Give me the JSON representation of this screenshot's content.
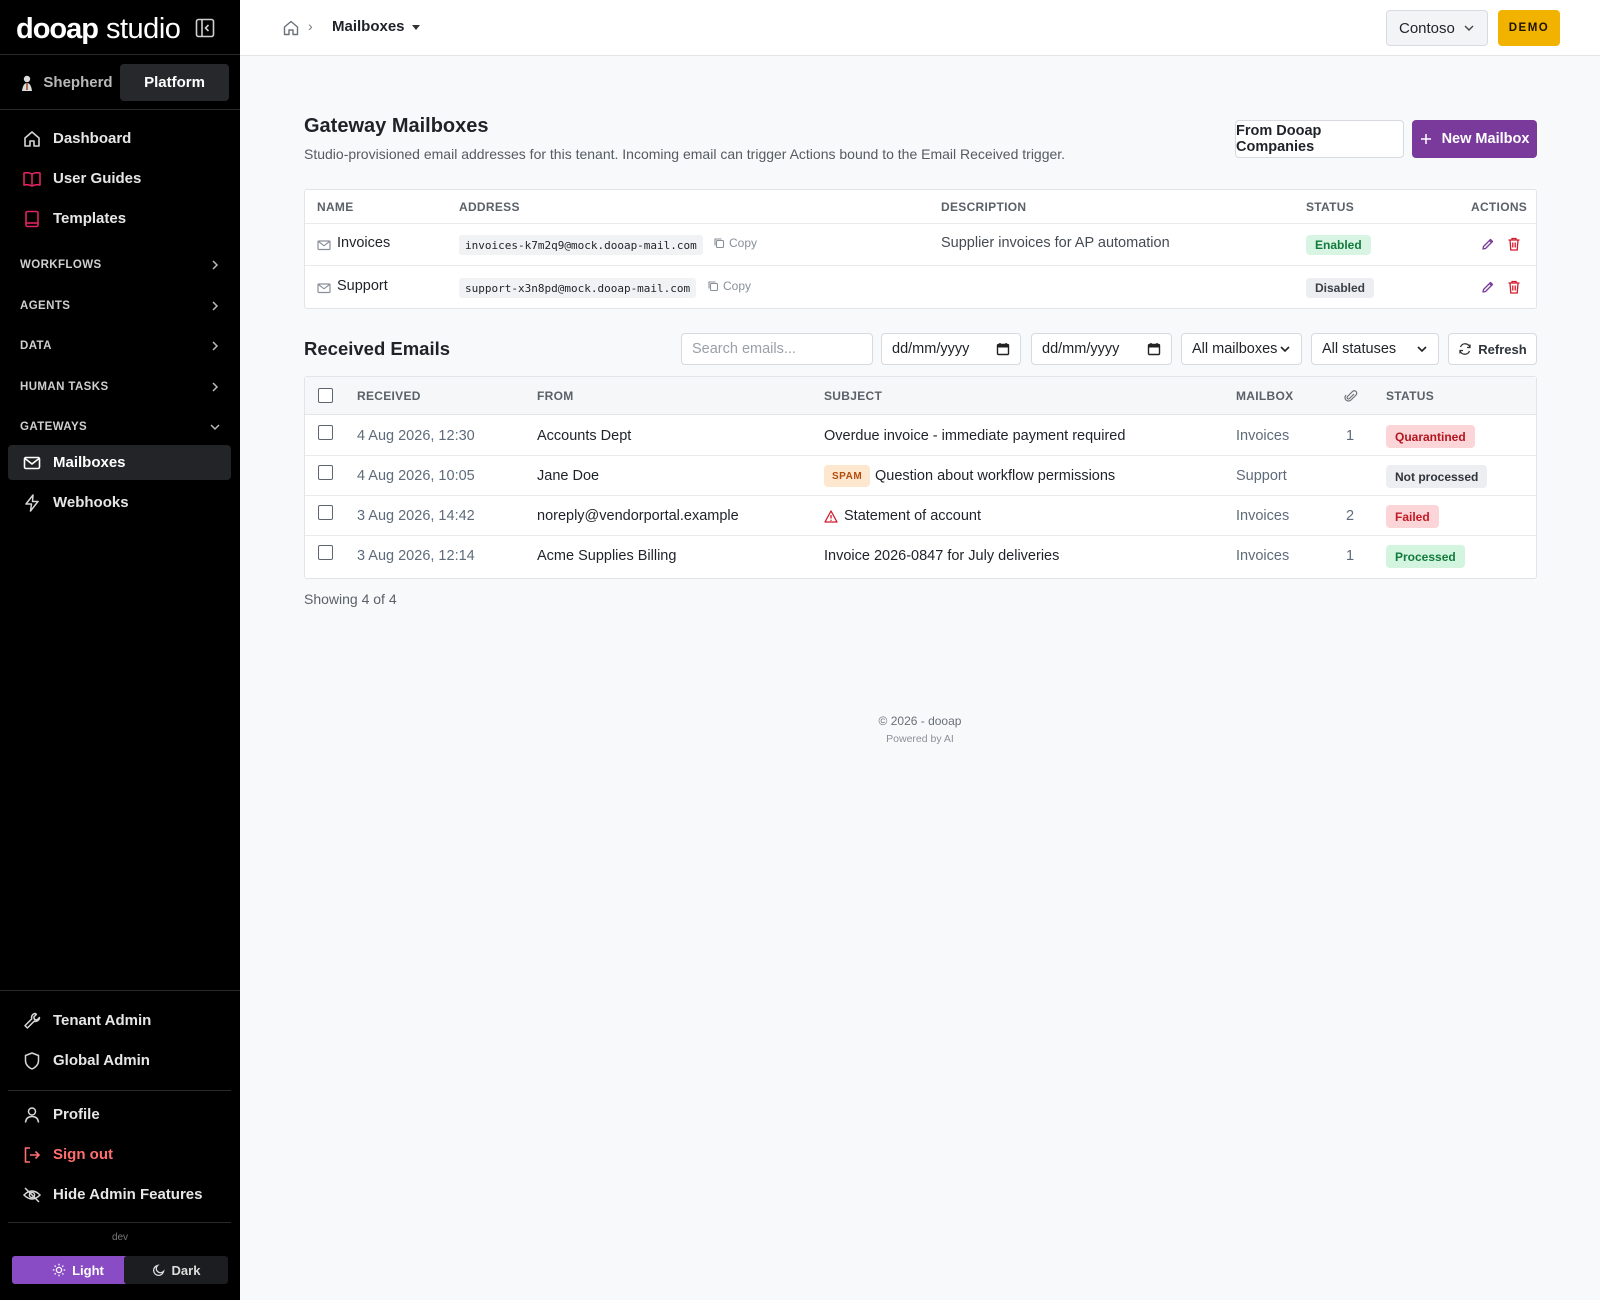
{
  "brand": {
    "name_bold": "dooap",
    "name_light": "studio"
  },
  "switcher": {
    "left": "Shepherd",
    "right": "Platform"
  },
  "nav": {
    "top_items": [
      {
        "label": "Dashboard",
        "icon": "home-icon"
      },
      {
        "label": "User Guides",
        "icon": "book-open-icon"
      },
      {
        "label": "Templates",
        "icon": "book-icon"
      }
    ],
    "sections": [
      {
        "label": "WORKFLOWS"
      },
      {
        "label": "AGENTS"
      },
      {
        "label": "DATA"
      },
      {
        "label": "HUMAN TASKS"
      },
      {
        "label": "GATEWAYS"
      }
    ],
    "gateway_items": [
      {
        "label": "Mailboxes",
        "icon": "mail-icon"
      },
      {
        "label": "Webhooks",
        "icon": "bolt-icon"
      }
    ],
    "admin_items": [
      {
        "label": "Tenant Admin",
        "icon": "wrench-icon"
      },
      {
        "label": "Global Admin",
        "icon": "shield-icon"
      }
    ],
    "account_items": [
      {
        "label": "Profile",
        "icon": "user-icon"
      },
      {
        "label": "Sign out",
        "icon": "sign-out-icon"
      },
      {
        "label": "Hide Admin Features",
        "icon": "eye-off-icon"
      }
    ],
    "env": "dev",
    "theme": {
      "light": "Light",
      "dark": "Dark"
    }
  },
  "topbar": {
    "breadcrumb_current": "Mailboxes",
    "tenant": "Contoso",
    "badge": "DEMO"
  },
  "page": {
    "title": "Gateway Mailboxes",
    "subtitle": "Studio-provisioned email addresses for this tenant. Incoming email can trigger Actions bound to the Email Received trigger.",
    "btn_from": "From Dooap Companies",
    "btn_new": "New Mailbox"
  },
  "mailboxes": {
    "columns": [
      "NAME",
      "ADDRESS",
      "DESCRIPTION",
      "STATUS",
      "ACTIONS"
    ],
    "copy_label": "Copy",
    "rows": [
      {
        "name": "Invoices",
        "address": "invoices-k7m2q9@mock.dooap-mail.com",
        "description": "Supplier invoices for AP automation",
        "status": "Enabled"
      },
      {
        "name": "Support",
        "address": "support-x3n8pd@mock.dooap-mail.com",
        "description": "",
        "status": "Disabled"
      }
    ]
  },
  "emails": {
    "title": "Received Emails",
    "search_placeholder": "Search emails...",
    "date_from": "dd/mm/yyyy",
    "date_to": "dd/mm/yyyy",
    "mailbox_filter": "All mailboxes",
    "status_filter": "All statuses",
    "refresh": "Refresh",
    "columns": [
      "RECEIVED",
      "FROM",
      "SUBJECT",
      "MAILBOX",
      "STATUS"
    ],
    "spam_label": "SPAM",
    "rows": [
      {
        "received": "4 Aug 2026, 12:30",
        "from": "Accounts Dept",
        "subject": "Overdue invoice - immediate payment required",
        "mailbox": "Invoices",
        "attachments": "1",
        "status": "Quarantined"
      },
      {
        "received": "4 Aug 2026, 10:05",
        "from": "Jane Doe",
        "subject": "Question about workflow permissions",
        "mailbox": "Support",
        "attachments": "",
        "status": "Not processed"
      },
      {
        "received": "3 Aug 2026, 14:42",
        "from": "noreply@vendorportal.example",
        "subject": "Statement of account",
        "mailbox": "Invoices",
        "attachments": "2",
        "status": "Failed"
      },
      {
        "received": "3 Aug 2026, 12:14",
        "from": "Acme Supplies Billing",
        "subject": "Invoice 2026-0847 for July deliveries",
        "mailbox": "Invoices",
        "attachments": "1",
        "status": "Processed"
      }
    ],
    "showing": "Showing 4 of 4"
  },
  "footer": {
    "copyright": "© 2026 - dooap",
    "powered": "Powered by AI"
  },
  "colors": {
    "accent": "#7a3a9c",
    "demo": "#f2b200",
    "sidebar": "#000000"
  }
}
